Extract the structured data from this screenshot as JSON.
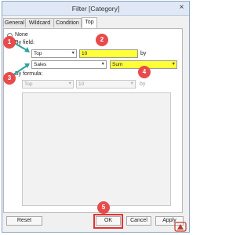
{
  "window": {
    "title": "Filter [Category]",
    "close_glyph": "×"
  },
  "tabs": [
    "General",
    "Wildcard",
    "Condition",
    "Top"
  ],
  "options": {
    "none_label": "None",
    "by_field_label": "By field:",
    "by_formula_label": "By formula:",
    "selected": "By field:"
  },
  "by_field": {
    "order": "Top",
    "count": "10",
    "by_label": "by",
    "field": "Sales",
    "aggregation": "Sum"
  },
  "by_formula": {
    "order": "Top",
    "count": "10",
    "by_label": "by"
  },
  "buttons": {
    "reset": "Reset",
    "ok": "OK",
    "cancel": "Cancel",
    "apply": "Apply"
  },
  "callouts": [
    "1",
    "2",
    "3",
    "4",
    "5"
  ],
  "colors": {
    "highlight": "#ffff38",
    "callout": "#e74b4b",
    "arrow": "#2fa39a"
  },
  "icons": {
    "dropdown": "chevron-down-icon",
    "close": "close-icon"
  }
}
